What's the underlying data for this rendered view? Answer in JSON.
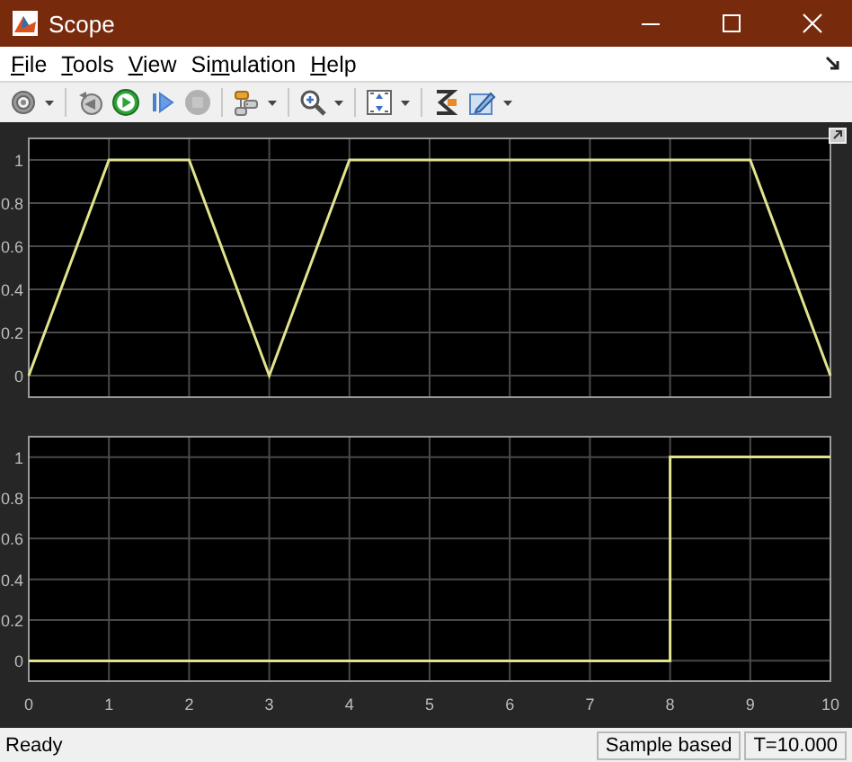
{
  "window": {
    "title": "Scope"
  },
  "menu": [
    {
      "key": "F",
      "post": "ile"
    },
    {
      "key": "T",
      "post": "ools"
    },
    {
      "key": "V",
      "post": "iew"
    },
    {
      "pre": "Si",
      "key": "m",
      "post": "ulation"
    },
    {
      "key": "H",
      "post": "elp"
    }
  ],
  "toolbar": [
    {
      "kind": "gear",
      "dropdown": true,
      "disabled": false
    },
    {
      "kind": "separator"
    },
    {
      "kind": "step-back",
      "dropdown": false,
      "disabled": false
    },
    {
      "kind": "run",
      "dropdown": false,
      "disabled": false
    },
    {
      "kind": "step-forward",
      "dropdown": false,
      "disabled": false
    },
    {
      "kind": "stop",
      "dropdown": false,
      "disabled": true
    },
    {
      "kind": "separator"
    },
    {
      "kind": "blocks",
      "dropdown": true,
      "disabled": false
    },
    {
      "kind": "separator"
    },
    {
      "kind": "zoom",
      "dropdown": true,
      "disabled": false
    },
    {
      "kind": "separator"
    },
    {
      "kind": "scale",
      "dropdown": true,
      "disabled": false
    },
    {
      "kind": "separator"
    },
    {
      "kind": "highlight",
      "dropdown": false,
      "disabled": false
    },
    {
      "kind": "style",
      "dropdown": true,
      "disabled": false
    }
  ],
  "plots": [
    {
      "chart_data": {
        "type": "line",
        "x": [
          0,
          1,
          2,
          3,
          4,
          5,
          6,
          7,
          8,
          9,
          10
        ],
        "xlim": [
          0,
          10
        ],
        "ylim": [
          -0.1,
          1.1
        ],
        "yticks": [
          0,
          0.2,
          0.4,
          0.6,
          0.8,
          1
        ],
        "grid": true,
        "series": [
          {
            "color": "#e3e38f",
            "values": [
              0,
              1,
              1,
              0,
              1,
              1,
              1,
              1,
              1,
              1,
              0
            ]
          }
        ]
      }
    },
    {
      "chart_data": {
        "type": "line",
        "x": [
          0,
          8,
          8,
          10
        ],
        "xlim": [
          0,
          10
        ],
        "ylim": [
          -0.1,
          1.1
        ],
        "xticks": [
          0,
          1,
          2,
          3,
          4,
          5,
          6,
          7,
          8,
          9,
          10
        ],
        "yticks": [
          0,
          0.2,
          0.4,
          0.6,
          0.8,
          1
        ],
        "grid": true,
        "series": [
          {
            "color": "#e3e38f",
            "values": [
              0,
              0,
              1,
              1
            ]
          }
        ]
      }
    }
  ],
  "status_bar": {
    "message": "Ready",
    "fields": [
      "Sample based",
      "T=10.000"
    ]
  }
}
